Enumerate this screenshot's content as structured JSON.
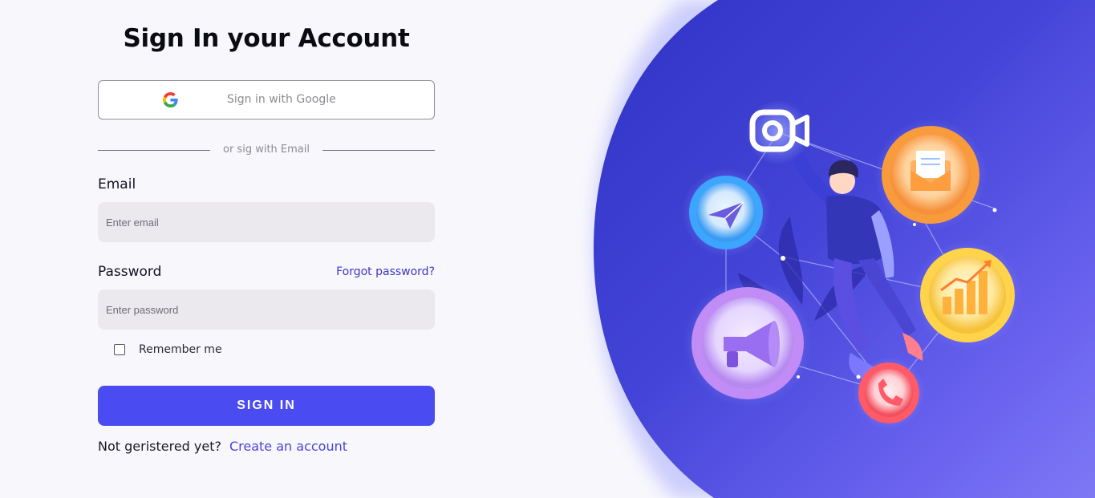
{
  "title": "Sign In your Account",
  "google_button": {
    "label": "Sign in with Google",
    "icon": "google-g-icon"
  },
  "divider_text": "or sig with Email",
  "email": {
    "label": "Email",
    "placeholder": "Enter email",
    "value": ""
  },
  "password": {
    "label": "Password",
    "placeholder": "Enter password",
    "value": "",
    "forgot_label": "Forgot password?"
  },
  "remember": {
    "label": "Remember me",
    "checked": false
  },
  "signin_button": {
    "label": "SIGN IN"
  },
  "footer": {
    "prompt": "Not geristered yet?",
    "link_label": "Create an account"
  },
  "illustration": {
    "icons": [
      "video-camera-icon",
      "paper-plane-icon",
      "envelope-icon",
      "bar-chart-icon",
      "megaphone-icon",
      "phone-icon"
    ]
  },
  "colors": {
    "accent": "#4a4bf0",
    "link": "#3b36c8",
    "input_bg": "#ebe8ee",
    "page_bg": "#f8f7fc",
    "art_blue": "#3a3ad4"
  }
}
